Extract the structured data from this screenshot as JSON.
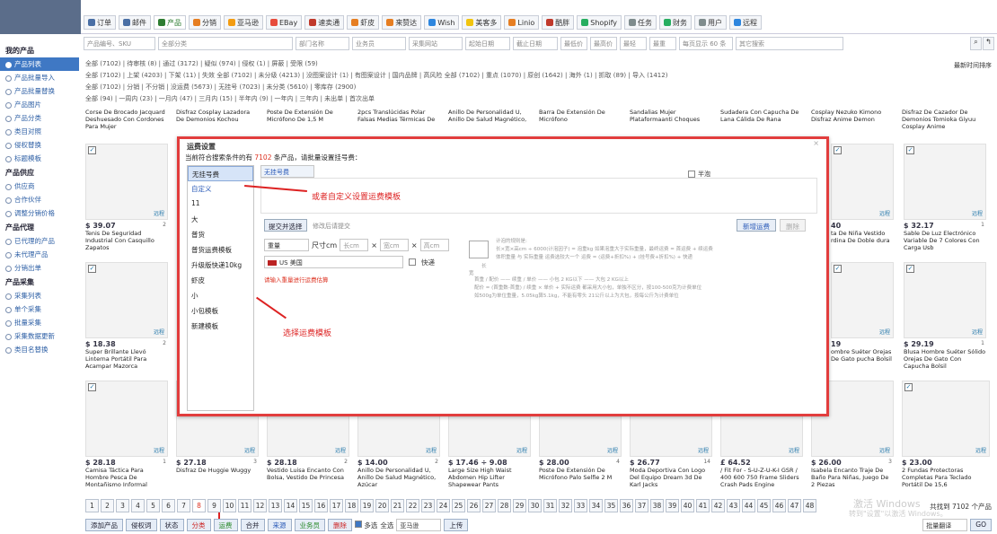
{
  "nav": {
    "tabs": [
      {
        "label": "订单",
        "color": "#4a6fa5"
      },
      {
        "label": "邮件",
        "color": "#4a6fa5"
      },
      {
        "label": "产品",
        "color": "#2e7d32"
      },
      {
        "label": "分销",
        "color": "#e67e22"
      },
      {
        "label": "亚马逊",
        "color": "#f39c12"
      },
      {
        "label": "EBay",
        "color": "#e74c3c"
      },
      {
        "label": "速卖通",
        "color": "#c0392b"
      },
      {
        "label": "虾皮",
        "color": "#e67e22"
      },
      {
        "label": "来赞达",
        "color": "#e67e22"
      },
      {
        "label": "Wish",
        "color": "#2e86de"
      },
      {
        "label": "美客多",
        "color": "#f1c40f"
      },
      {
        "label": "Linio",
        "color": "#e67e22"
      },
      {
        "label": "酷胖",
        "color": "#c0392b"
      },
      {
        "label": "Shopify",
        "color": "#27ae60"
      },
      {
        "label": "任务",
        "color": "#7f8c8d"
      },
      {
        "label": "财务",
        "color": "#27ae60"
      },
      {
        "label": "用户",
        "color": "#7f8c8d"
      },
      {
        "label": "远程",
        "color": "#2e86de"
      }
    ]
  },
  "filters": [
    "产品编号、SKU",
    "全部分类",
    "部门名称",
    "业务员",
    "采集网站",
    "起始日期",
    "截止日期",
    "最低价",
    "最高价",
    "最轻",
    "最重",
    "每页显示 60 条",
    "其它搜索"
  ],
  "sidebar": {
    "my_products": "我的产品",
    "items_a": [
      "产品列表",
      "产品批量导入",
      "产品批量替换",
      "产品图片",
      "产品分类",
      "类目对照",
      "侵权替换",
      "标题模板"
    ],
    "supply": "产品供应",
    "items_b": [
      "供应商",
      "合作伙伴",
      "调整分销价格"
    ],
    "agency": "产品代理",
    "items_c": [
      "已代理的产品",
      "未代理产品",
      "分销出单"
    ],
    "collect": "产品采集",
    "items_d": [
      "采集列表",
      "单个采集",
      "批量采集",
      "采集数据更新",
      "类目名替换"
    ]
  },
  "stats": {
    "row1": "全部 (7102) | 待审核 (8) | 通过 (3172) | 疑似 (974) | 侵权 (1) | 屏蔽 | 受限 (59)",
    "row2": "全部 (7102) | 上架 (4203) | 下架 (11) | 失效    全部 (7102) | 未分级 (4213) | 没图案设计 (1) | 有图案设计 | 国内品牌 | 高风险    全部 (7102) | 重点 (1070) | 原创 (1642) | 海外 (1) | 抓取 (89) | 导入 (1412)",
    "row3": "全部 (7102) | 分销 | 不分销 | 没运费 (5673) | 无挂号 (7023) | 未分类 (5610) | 零库存 (2900)",
    "row4": "全部 (94) | 一周内 (23) | 一月内 (47) | 三月内 (15) | 半年内 (9) | 一年内 | 三年内 | 未出单 |  首次出单",
    "sort": "最新时间排序"
  },
  "top_titles": [
    "Corse De Brocado Jacquard Deshuesado Con Cordones Para Mujer",
    "Disfraz Cosplay Lazadora De Demonios Kochou",
    "Poste De Extensión De Micrófono De 1,5 M",
    "2pcs Translúcidas Polar Falsas Medias Térmicas De",
    "Anillo De Personalidad U, Anillo De Salud Magnético,",
    "Barra De Extensión De Micrófono",
    "Sandalias Mujer Plataformaanti Choques",
    "Sudadera Con Capucha De Lana Cálida De Rana",
    "Cosplay Nezuko Kimono Disfraz Anime Demon",
    "Disfraz De Cazador De Demonios Tomioka Giyuu Cosplay Anime"
  ],
  "row1_cards": [
    {
      "price": "$ 39.07",
      "cnt": "2",
      "title": "Tenis De Seguridad Industrial Con Casquillo Zapatos"
    },
    {
      "price": "40",
      "cnt": "",
      "title": "ta De Niña Vestido rdina De Doble dura"
    },
    {
      "price": "$ 32.17",
      "cnt": "1",
      "title": "Sable De Luz Electrónico Variable De 7 Colores Con Carga Usb"
    }
  ],
  "row2_cards": [
    {
      "price": "$ 18.38",
      "cnt": "2",
      "title": "Super Brillante Llevó Linterna Portátil Para Acampar Mazorca"
    },
    {
      "price": "19",
      "cnt": "",
      "title": "ombre Suéter Orejas De Gato pucha Bolsil"
    },
    {
      "price": "$ 29.19",
      "cnt": "1",
      "title": "Blusa Hombre Suéter Sólido Orejas De Gato Con Capucha Bolsil"
    }
  ],
  "row3_cards": [
    {
      "price": "$ 28.18",
      "cnt": "1",
      "title": "Camisa Táctica Para Hombre Pesca De Montañismo Informal"
    },
    {
      "price": "$ 27.18",
      "cnt": "3",
      "title": "Disfraz De Huggie Wuggy"
    },
    {
      "price": "$ 28.18",
      "cnt": "2",
      "title": "Vestido Luisa Encanto Con Bolsa, Vestido De Princesa"
    },
    {
      "price": "$ 14.00",
      "cnt": "2",
      "title": "Anillo De Personalidad U, Anillo De Salud Magnético, Azúcar"
    },
    {
      "price": "$ 17.46 ÷ 9.08",
      "cnt": "",
      "title": "Large Size High Waist Abdomen Hip Lifter Shapewear Pants"
    },
    {
      "price": "$ 28.00",
      "cnt": "4",
      "title": "Poste De Extensión De Micrófono Palo Selfie 2 M"
    },
    {
      "price": "$ 26.77",
      "cnt": "14",
      "title": "Moda Deportiva Con Logo Del Equipo Dream 3d De Karl Jacks"
    },
    {
      "price": "£ 64.52",
      "cnt": "",
      "title": "/ Fit For - S-U-Z-U-K-I GSR / 400 600 750 Frame Sliders Crash Pads Engine"
    },
    {
      "price": "$ 26.00",
      "cnt": "3",
      "title": "Isabela Encanto Traje De Baño Para Niñas, Juego De 2 Piezas"
    },
    {
      "price": "$ 23.00",
      "cnt": "",
      "title": "2 Fundas Protectoras Completas Para Teclado Portátil De 15,6"
    }
  ],
  "source_label": "远程",
  "modal": {
    "title": "运费设置",
    "sub_prefix": "当前符合搜索条件的有",
    "sub_count": "7102",
    "sub_suffix": "条产品，请批量设置挂号费：",
    "templates": [
      "无挂号费",
      "自定义",
      "11",
      "大",
      "普货",
      "普货运费模板",
      "升级版快递10kg",
      "虾皮",
      "小",
      "小包模板",
      "新建模板"
    ],
    "name_value": "无挂号费",
    "checkbox_label": "半泡",
    "submit_btn": "提交并选择",
    "submit_note": "修改后请提交",
    "new_btn": "新增运费",
    "del_btn": "删除",
    "weight_sel": "重量",
    "size_label": "尺寸cm",
    "length_ph": "长cm",
    "width_ph": "宽cm",
    "height_ph": "高cm",
    "country_sel": "US 美国",
    "express_label": "快递",
    "warn": "请输入重量进行运费估算",
    "close": "×",
    "diag_lines": [
      "计泡的规则是:",
      "长×宽×高cm ÷ 6000(计泡因子) = 泡重kg    如果泡重大于实际重量，最终运费 = 首运费 + 续运费",
      "体积重量 与 实际重量 运费选较大一个    运费 = (运费+折扣%) + (挂号费+折扣%) + 快递",
      "长",
      "宽",
      "首重 / 配价  ——  续重 / 单价  ——  小包 2 KG以下  ——  大包 2 KG以上",
      "配价 = (首重数-首重) / 续重 × 单价 + 实际运费    都采用大小包，单独不区分，按100-500克为计费单位",
      "如500g为单位重量，5.05kg算5.1kg，不能有零头    21公斤以上为大包，按每公斤为计费单位"
    ]
  },
  "annotations": {
    "a1": "或者自定义设置运费模板",
    "a2": "选择运费模板"
  },
  "pages": [
    "1",
    "2",
    "3",
    "4",
    "5",
    "6",
    "7",
    "8",
    "9",
    "10",
    "11",
    "12",
    "13",
    "14",
    "15",
    "16",
    "17",
    "18",
    "19",
    "20",
    "21",
    "22",
    "23",
    "24",
    "25",
    "26",
    "27",
    "28",
    "29",
    "30",
    "31",
    "32",
    "33",
    "34",
    "35",
    "36",
    "37",
    "38",
    "39",
    "40",
    "41",
    "42",
    "43",
    "44",
    "45",
    "46",
    "47",
    "48"
  ],
  "total": "共找到 7102 个产品",
  "watermark": "激活 Windows",
  "watermark2": "转到\"设置\"以激活 Windows。",
  "bottom": {
    "buttons": [
      "添加产品",
      "侵权词",
      "状态",
      "分类",
      "运费",
      "合并",
      "来源",
      "业务员",
      "删除"
    ],
    "multi": "多选",
    "all": "全选",
    "platform": "亚马逊",
    "upload": "上传",
    "translate": "批量翻译",
    "go": "GO"
  }
}
